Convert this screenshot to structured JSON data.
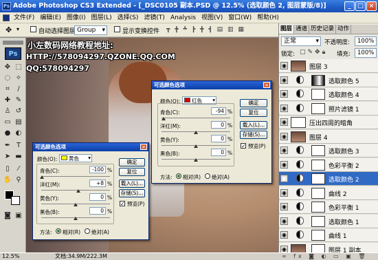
{
  "window": {
    "title": "Adobe Photoshop CS3 Extended - [_DSC0105 副本.PSD @ 12.5% (选取颜色 2, 图层蒙版/8)]",
    "app_icon": "Ps"
  },
  "menu": [
    "文件(F)",
    "编辑(E)",
    "图像(I)",
    "图层(L)",
    "选择(S)",
    "滤镜(T)",
    "Analysis",
    "视图(V)",
    "窗口(W)",
    "帮助(H)"
  ],
  "options": {
    "auto_select_label": "自动选择图层",
    "auto_select_value": "Group",
    "show_transform_label": "显示变换控件"
  },
  "watermark": {
    "line1": "小左数码网络教程地址:",
    "line2": "HTTP://578094297.QZONE.QQ.COM",
    "line3": "QQ:578094297"
  },
  "status": {
    "zoom": "12.5%",
    "doc": "文档:34.9M/222.3M"
  },
  "panel": {
    "tabs": [
      "图层",
      "通道",
      "历史记录",
      "动作"
    ],
    "blend_mode": "正常",
    "opacity_label": "不透明度:",
    "opacity_value": "100%",
    "lock_label": "锁定:",
    "fill_label": "填充:",
    "fill_value": "100%",
    "layers": [
      {
        "name": "图层 3",
        "type": "image"
      },
      {
        "name": "选取颜色 5",
        "type": "adj"
      },
      {
        "name": "选取颜色 4",
        "type": "adj"
      },
      {
        "name": "照片滤镜 1",
        "type": "adj"
      },
      {
        "name": "压出四周的暗角",
        "type": "text"
      },
      {
        "name": "图层 4",
        "type": "image"
      },
      {
        "name": "选取颜色 3",
        "type": "adj"
      },
      {
        "name": "色彩平衡 2",
        "type": "adj"
      },
      {
        "name": "选取颜色 2",
        "type": "adj",
        "selected": true
      },
      {
        "name": "曲线 2",
        "type": "adj"
      },
      {
        "name": "色彩平衡 1",
        "type": "adj"
      },
      {
        "name": "选取颜色 1",
        "type": "adj"
      },
      {
        "name": "曲线 1",
        "type": "adj"
      },
      {
        "name": "图层 1 副本",
        "type": "image"
      }
    ]
  },
  "dialog_small": {
    "title": "可选颜色选项",
    "color_label": "颜色(O):",
    "color_value": "黄色",
    "rows": [
      {
        "label": "青色(C):",
        "value": "-100",
        "unit": "%"
      },
      {
        "label": "洋红(M):",
        "value": "+8",
        "unit": "%"
      },
      {
        "label": "黄色(Y):",
        "value": "0",
        "unit": "%"
      },
      {
        "label": "黑色(B):",
        "value": "0",
        "unit": "%"
      }
    ],
    "buttons": [
      "确定",
      "复位",
      "载入(L)...",
      "存储(S)..."
    ],
    "preview_label": "预览(P)",
    "method_label": "方法:",
    "relative": "相对(R)",
    "absolute": "绝对(A)"
  },
  "dialog_large": {
    "title": "可选颜色选项",
    "color_label": "颜色(O):",
    "color_value": "红色",
    "rows": [
      {
        "label": "青色(C):",
        "value": "-94",
        "unit": "%"
      },
      {
        "label": "洋红(M):",
        "value": "0",
        "unit": "%"
      },
      {
        "label": "黄色(Y):",
        "value": "0",
        "unit": "%"
      },
      {
        "label": "黑色(B):",
        "value": "0",
        "unit": "%"
      }
    ],
    "buttons": [
      "确定",
      "复位",
      "载入(L)...",
      "存储(S)..."
    ],
    "preview_label": "预览(P)",
    "method_label": "方法:",
    "relative": "相对(R)",
    "absolute": "绝对(A)"
  }
}
